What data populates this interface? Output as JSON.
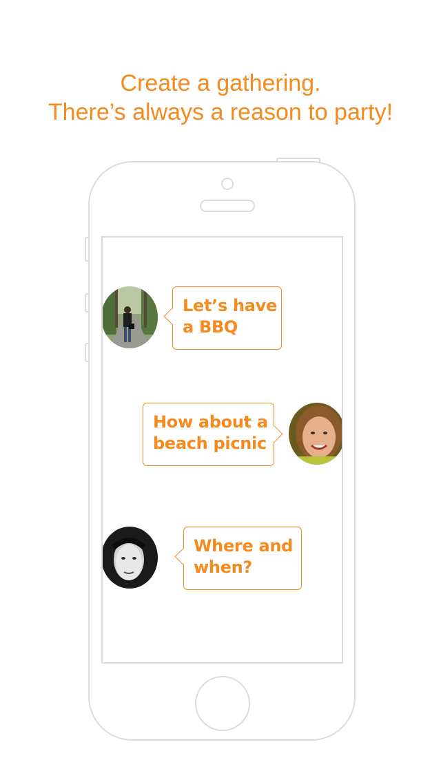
{
  "headline": {
    "line1": "Create a gathering.",
    "line2": "There’s always a reason to party!"
  },
  "accent_color": "#f58a1f",
  "outline_color": "#dcdcdc",
  "chat": {
    "messages": [
      {
        "avatar_icon": "man-on-road-avatar",
        "side": "left",
        "line1": "Let’s have",
        "line2": "a BBQ"
      },
      {
        "avatar_icon": "smiling-woman-avatar",
        "side": "right",
        "line1": "How about a",
        "line2": "beach picnic"
      },
      {
        "avatar_icon": "curly-hair-woman-avatar",
        "side": "left",
        "line1": "Where and",
        "line2": "when?"
      }
    ]
  }
}
